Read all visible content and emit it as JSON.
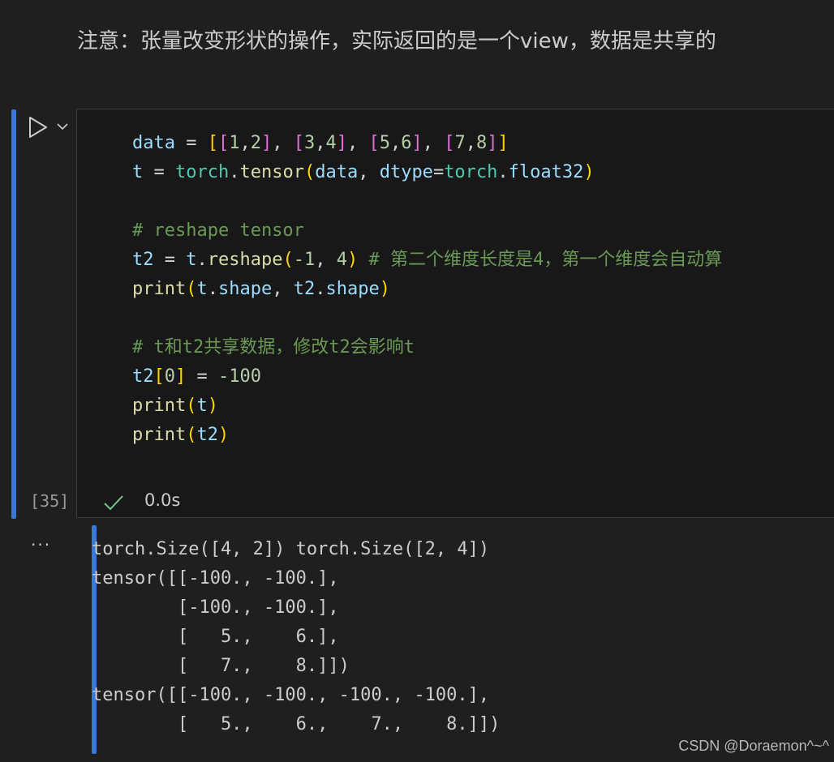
{
  "markdown": {
    "text": "注意：张量改变形状的操作，实际返回的是一个view，数据是共享的"
  },
  "cell": {
    "execution_count": "[35]",
    "status_time": "0.0s",
    "code_lines": [
      [
        {
          "t": "data",
          "c": "#9cdcfe"
        },
        {
          "t": " = ",
          "c": "#d4d4d4"
        },
        {
          "t": "[",
          "c": "#ffd700"
        },
        {
          "t": "[",
          "c": "#da70d6"
        },
        {
          "t": "1",
          "c": "#b5cea8"
        },
        {
          "t": ",",
          "c": "#d4d4d4"
        },
        {
          "t": "2",
          "c": "#b5cea8"
        },
        {
          "t": "]",
          "c": "#da70d6"
        },
        {
          "t": ", ",
          "c": "#d4d4d4"
        },
        {
          "t": "[",
          "c": "#da70d6"
        },
        {
          "t": "3",
          "c": "#b5cea8"
        },
        {
          "t": ",",
          "c": "#d4d4d4"
        },
        {
          "t": "4",
          "c": "#b5cea8"
        },
        {
          "t": "]",
          "c": "#da70d6"
        },
        {
          "t": ", ",
          "c": "#d4d4d4"
        },
        {
          "t": "[",
          "c": "#da70d6"
        },
        {
          "t": "5",
          "c": "#b5cea8"
        },
        {
          "t": ",",
          "c": "#d4d4d4"
        },
        {
          "t": "6",
          "c": "#b5cea8"
        },
        {
          "t": "]",
          "c": "#da70d6"
        },
        {
          "t": ", ",
          "c": "#d4d4d4"
        },
        {
          "t": "[",
          "c": "#da70d6"
        },
        {
          "t": "7",
          "c": "#b5cea8"
        },
        {
          "t": ",",
          "c": "#d4d4d4"
        },
        {
          "t": "8",
          "c": "#b5cea8"
        },
        {
          "t": "]",
          "c": "#da70d6"
        },
        {
          "t": "]",
          "c": "#ffd700"
        }
      ],
      [
        {
          "t": "t",
          "c": "#9cdcfe"
        },
        {
          "t": " = ",
          "c": "#d4d4d4"
        },
        {
          "t": "torch",
          "c": "#4ec9b0"
        },
        {
          "t": ".",
          "c": "#d4d4d4"
        },
        {
          "t": "tensor",
          "c": "#dcdcaa"
        },
        {
          "t": "(",
          "c": "#ffd700"
        },
        {
          "t": "data",
          "c": "#9cdcfe"
        },
        {
          "t": ", ",
          "c": "#d4d4d4"
        },
        {
          "t": "dtype",
          "c": "#9cdcfe"
        },
        {
          "t": "=",
          "c": "#d4d4d4"
        },
        {
          "t": "torch",
          "c": "#4ec9b0"
        },
        {
          "t": ".",
          "c": "#d4d4d4"
        },
        {
          "t": "float32",
          "c": "#9cdcfe"
        },
        {
          "t": ")",
          "c": "#ffd700"
        }
      ],
      [],
      [
        {
          "t": "# reshape tensor",
          "c": "#6a9955"
        }
      ],
      [
        {
          "t": "t2",
          "c": "#9cdcfe"
        },
        {
          "t": " = ",
          "c": "#d4d4d4"
        },
        {
          "t": "t",
          "c": "#9cdcfe"
        },
        {
          "t": ".",
          "c": "#d4d4d4"
        },
        {
          "t": "reshape",
          "c": "#dcdcaa"
        },
        {
          "t": "(",
          "c": "#ffd700"
        },
        {
          "t": "-1",
          "c": "#b5cea8"
        },
        {
          "t": ", ",
          "c": "#d4d4d4"
        },
        {
          "t": "4",
          "c": "#b5cea8"
        },
        {
          "t": ")",
          "c": "#ffd700"
        },
        {
          "t": " # 第二个维度长度是4，第一个维度会自动算",
          "c": "#6a9955"
        }
      ],
      [
        {
          "t": "print",
          "c": "#dcdcaa"
        },
        {
          "t": "(",
          "c": "#ffd700"
        },
        {
          "t": "t",
          "c": "#9cdcfe"
        },
        {
          "t": ".",
          "c": "#d4d4d4"
        },
        {
          "t": "shape",
          "c": "#9cdcfe"
        },
        {
          "t": ", ",
          "c": "#d4d4d4"
        },
        {
          "t": "t2",
          "c": "#9cdcfe"
        },
        {
          "t": ".",
          "c": "#d4d4d4"
        },
        {
          "t": "shape",
          "c": "#9cdcfe"
        },
        {
          "t": ")",
          "c": "#ffd700"
        }
      ],
      [],
      [
        {
          "t": "# t和t2共享数据，修改t2会影响t",
          "c": "#6a9955"
        }
      ],
      [
        {
          "t": "t2",
          "c": "#9cdcfe"
        },
        {
          "t": "[",
          "c": "#ffd700"
        },
        {
          "t": "0",
          "c": "#b5cea8"
        },
        {
          "t": "]",
          "c": "#ffd700"
        },
        {
          "t": " = ",
          "c": "#d4d4d4"
        },
        {
          "t": "-100",
          "c": "#b5cea8"
        }
      ],
      [
        {
          "t": "print",
          "c": "#dcdcaa"
        },
        {
          "t": "(",
          "c": "#ffd700"
        },
        {
          "t": "t",
          "c": "#9cdcfe"
        },
        {
          "t": ")",
          "c": "#ffd700"
        }
      ],
      [
        {
          "t": "print",
          "c": "#dcdcaa"
        },
        {
          "t": "(",
          "c": "#ffd700"
        },
        {
          "t": "t2",
          "c": "#9cdcfe"
        },
        {
          "t": ")",
          "c": "#ffd700"
        }
      ]
    ]
  },
  "output": {
    "more_label": "···",
    "text": "torch.Size([4, 2]) torch.Size([2, 4])\ntensor([[-100., -100.],\n        [-100., -100.],\n        [   5.,    6.],\n        [   7.,    8.]])\ntensor([[-100., -100., -100., -100.],\n        [   5.,    6.,    7.,    8.]])"
  },
  "watermark": "CSDN @Doraemon^~^",
  "colors": {
    "accent_bar": "#3a78d8",
    "success_check": "#73c991"
  },
  "icons": [
    "run-icon",
    "chevron-down-icon",
    "check-icon"
  ]
}
